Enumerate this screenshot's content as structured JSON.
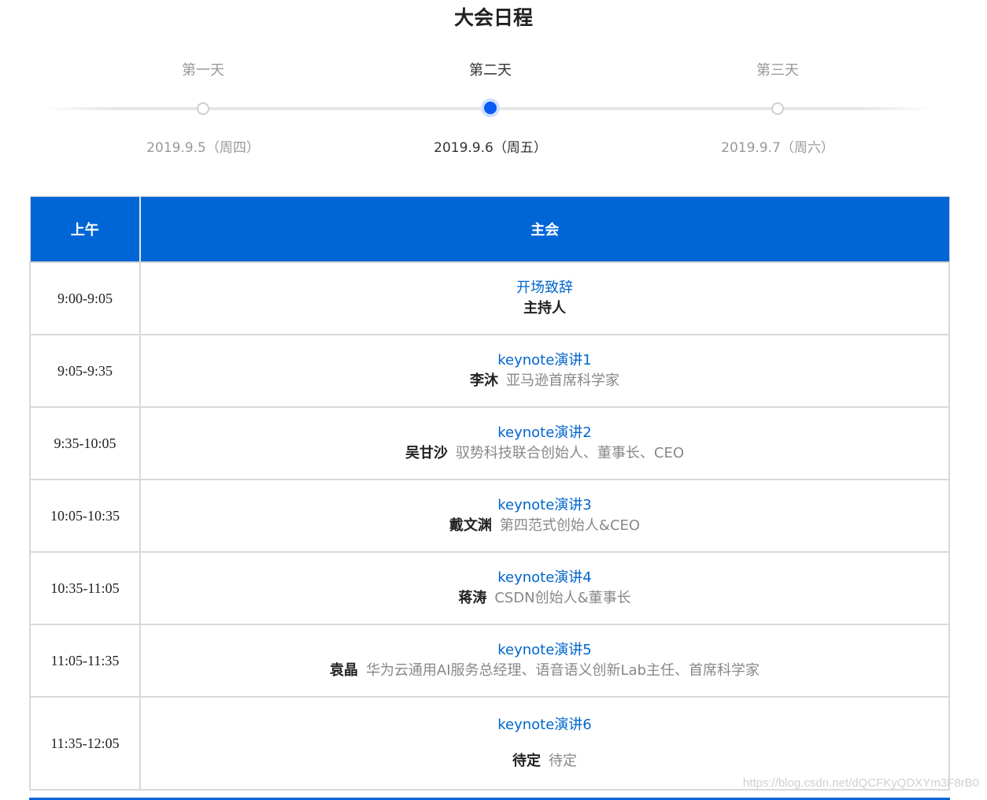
{
  "title": "大会日程",
  "days": [
    {
      "name": "第一天",
      "date": "2019.9.5（周四）",
      "active": false
    },
    {
      "name": "第二天",
      "date": "2019.9.6（周五）",
      "active": true
    },
    {
      "name": "第三天",
      "date": "2019.9.7（周六）",
      "active": false
    }
  ],
  "table": {
    "header_time": "上午",
    "header_main": "主会",
    "rows": [
      {
        "time": "9:00-9:05",
        "title": "开场致辞",
        "speaker": "主持人",
        "role": ""
      },
      {
        "time": "9:05-9:35",
        "title": "keynote演讲1",
        "speaker": "李沐",
        "role": "亚马逊首席科学家"
      },
      {
        "time": "9:35-10:05",
        "title": "keynote演讲2",
        "speaker": "吴甘沙",
        "role": "驭势科技联合创始人、董事长、CEO"
      },
      {
        "time": "10:05-10:35",
        "title": "keynote演讲3",
        "speaker": "戴文渊",
        "role": "第四范式创始人&CEO"
      },
      {
        "time": "10:35-11:05",
        "title": "keynote演讲4",
        "speaker": "蒋涛",
        "role": "CSDN创始人&董事长"
      },
      {
        "time": "11:05-11:35",
        "title": "keynote演讲5",
        "speaker": "袁晶",
        "role": "华为云通用AI服务总经理、语音语义创新Lab主任、首席科学家"
      },
      {
        "time": "11:35-12:05",
        "title": "keynote演讲6",
        "speaker": "待定",
        "role": "待定"
      }
    ]
  },
  "watermark": "https://blog.csdn.net/dQCFKyQDXYm3F8rB0",
  "colors": {
    "accent": "#0066d6",
    "active_dot": "#0a5cf5",
    "link": "#0066cc"
  }
}
